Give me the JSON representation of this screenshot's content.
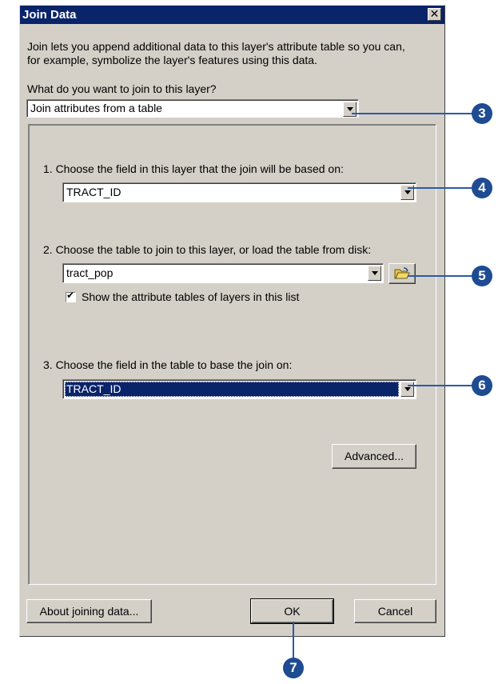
{
  "window": {
    "title": "Join Data",
    "close_glyph": "✕"
  },
  "intro_text_line1": "Join lets you append additional data to this layer's attribute table so you can,",
  "intro_text_line2": "for example, symbolize the layer's features using this data.",
  "join_question": "What do you want to join to this layer?",
  "join_type": {
    "value": "Join attributes from a table"
  },
  "step1": {
    "label": "1.  Choose the field in this layer that the join will be based on:",
    "value": "TRACT_ID"
  },
  "step2": {
    "label": "2.  Choose the table to join to this layer, or load the table from disk:",
    "value": "tract_pop",
    "checkbox_label": "Show the attribute tables of layers in this list",
    "checkbox_checked": true
  },
  "step3": {
    "label": "3.  Choose the field in the table to base the join on:",
    "value": "TRACT_ID"
  },
  "buttons": {
    "advanced": "Advanced...",
    "about": "About joining data...",
    "ok": "OK",
    "cancel": "Cancel"
  },
  "callouts": [
    "3",
    "4",
    "5",
    "6",
    "7"
  ],
  "colors": {
    "title_bar": "#0a246a",
    "callout": "#1e4b92",
    "selection": "#0a246a",
    "dialog_bg": "#d4d0c8"
  },
  "icons": {
    "open_folder": "open-folder-icon"
  }
}
